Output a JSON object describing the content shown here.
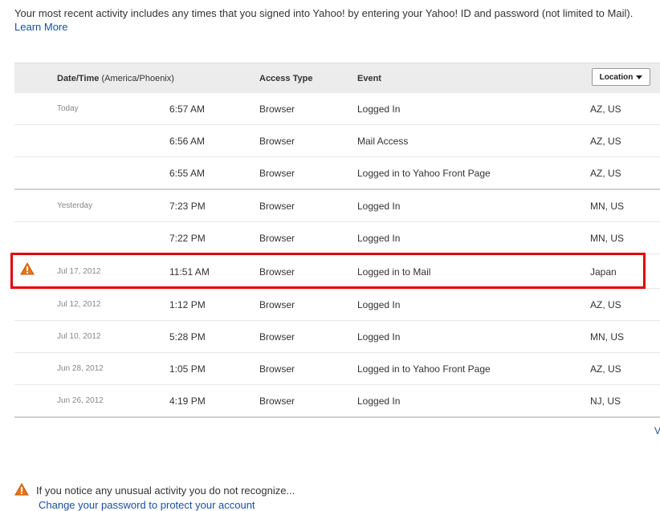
{
  "intro": {
    "text": "Your most recent activity includes any times that you signed into Yahoo! by entering your Yahoo! ID and password (not limited to Mail).",
    "learn_more": "Learn More"
  },
  "table": {
    "headers": {
      "datetime": "Date/Time",
      "timezone": "(America/Phoenix)",
      "access_type": "Access Type",
      "event": "Event",
      "location_button": "Location"
    },
    "rows": [
      {
        "date": "Today",
        "time": "6:57 AM",
        "access": "Browser",
        "event": "Logged In",
        "location": "AZ, US"
      },
      {
        "date": "",
        "time": "6:56 AM",
        "access": "Browser",
        "event": "Mail Access",
        "location": "AZ, US"
      },
      {
        "date": "",
        "time": "6:55 AM",
        "access": "Browser",
        "event": "Logged in to Yahoo Front Page",
        "location": "AZ, US"
      },
      {
        "date": "Yesterday",
        "time": "7:23 PM",
        "access": "Browser",
        "event": "Logged In",
        "location": "MN, US"
      },
      {
        "date": "",
        "time": "7:22 PM",
        "access": "Browser",
        "event": "Logged In",
        "location": "MN, US"
      },
      {
        "date": "Jul 17, 2012",
        "time": "11:51 AM",
        "access": "Browser",
        "event": "Logged in to Mail",
        "location": "Japan"
      },
      {
        "date": "Jul 12, 2012",
        "time": "1:12 PM",
        "access": "Browser",
        "event": "Logged In",
        "location": "AZ, US"
      },
      {
        "date": "Jul 10, 2012",
        "time": "5:28 PM",
        "access": "Browser",
        "event": "Logged In",
        "location": "MN, US"
      },
      {
        "date": "Jun 28, 2012",
        "time": "1:05 PM",
        "access": "Browser",
        "event": "Logged in to Yahoo Front Page",
        "location": "AZ, US"
      },
      {
        "date": "Jun 26, 2012",
        "time": "4:19 PM",
        "access": "Browser",
        "event": "Logged In",
        "location": "NJ, US"
      }
    ]
  },
  "view_more": "V",
  "notice": {
    "text": "If you notice any unusual activity you do not recognize...",
    "link": "Change your password to protect your account"
  },
  "colors": {
    "highlight": "#e00000",
    "warning": "#e8731a",
    "link": "#1a4fa0"
  },
  "icons": {
    "warning": "warning-icon"
  }
}
